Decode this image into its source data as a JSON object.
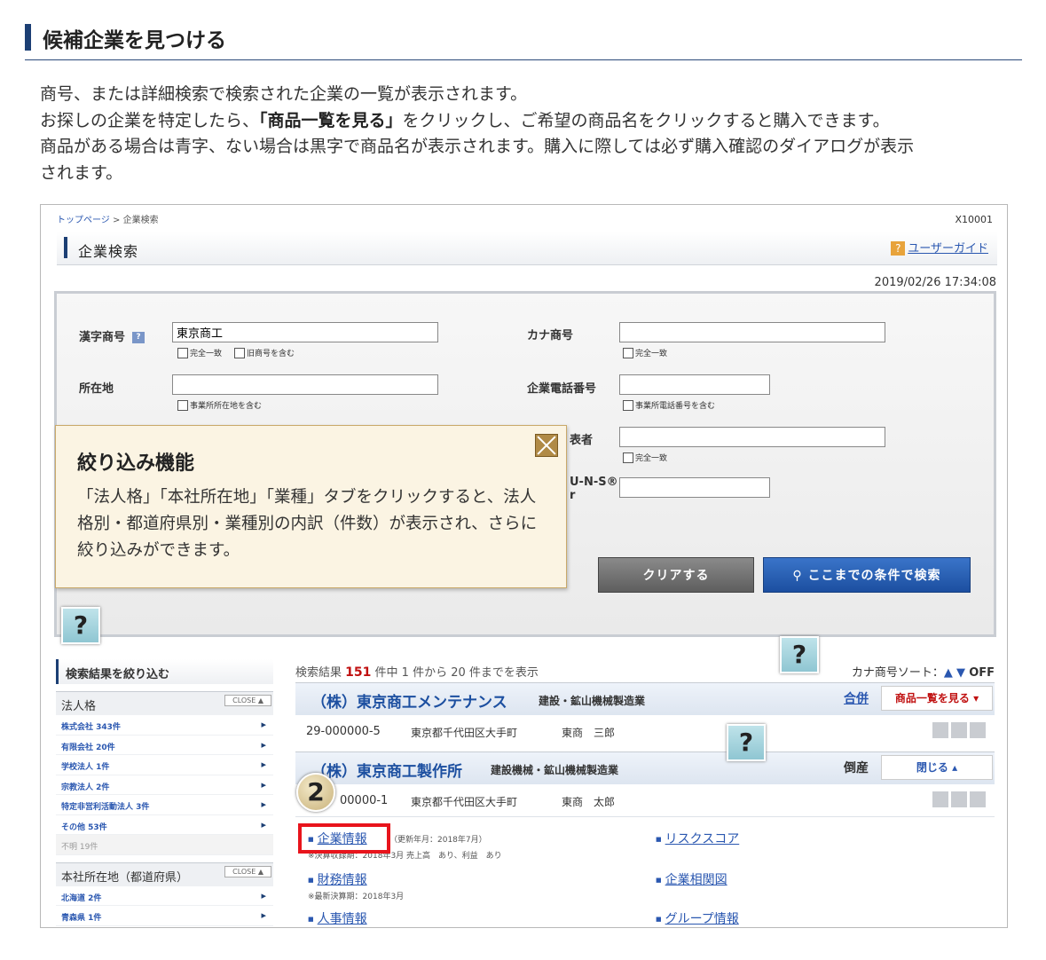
{
  "guide": {
    "title": "候補企業を見つける",
    "intro_line1": "商号、または詳細検索で検索された企業の一覧が表示されます。",
    "intro_line2_pre": "お探しの企業を特定したら、",
    "intro_line2_bold": "「商品一覧を見る」",
    "intro_line2_post": "をクリックし、ご希望の商品名をクリックすると購入できます。",
    "intro_line3": "商品がある場合は青字、ない場合は黒字で商品名が表示されます。購入に際しては必ず購入確認のダイアログが表示",
    "intro_line4": "されます。"
  },
  "screen": {
    "breadcrumb_top": "トップページ",
    "breadcrumb_sep": ">",
    "breadcrumb_current": "企業検索",
    "screen_id": "X10001",
    "page_title": "企業検索",
    "help_q": "?",
    "user_guide": "ユーザーガイド",
    "datetime": "2019/02/26 17:34:08"
  },
  "form": {
    "kanji_label": "漢字商号",
    "kanji_value": "東京商工",
    "chk_exact": "完全一致",
    "chk_former": "旧商号を含む",
    "kana_label": "カナ商号",
    "kana_value": "",
    "location_label": "所在地",
    "location_value": "",
    "chk_office_location": "事業所所在地を含む",
    "phone_label": "企業電話番号",
    "phone_value": "",
    "chk_office_phone": "事業所電話番号を含む",
    "rep_label_partial": "表者",
    "rep_value": "",
    "duns_label_partial": "U-N-S®",
    "duns_label_partial2": "r",
    "duns_value": "",
    "clear_btn": "クリアする",
    "search_btn": "ここまでの条件で検索"
  },
  "popup": {
    "title": "絞り込み機能",
    "body": "「法人格」「本社所在地」「業種」タブをクリックすると、法人格別・都道府県別・業種別の内訳（件数）が表示され、さらに絞り込みができます。"
  },
  "help_marks": [
    "?",
    "?",
    "?"
  ],
  "sidebar": {
    "heading": "検索結果を絞り込む",
    "close": "CLOSE ▲",
    "cat1": "法人格",
    "items1": [
      "株式会社 343件",
      "有限会社 20件",
      "学校法人 1件",
      "宗教法人 2件",
      "特定非営利活動法人 3件",
      "その他 53件"
    ],
    "disabled1": "不明 19件",
    "cat2": "本社所在地（都道府県）",
    "items2": [
      "北海道 2件",
      "青森県 1件"
    ]
  },
  "results": {
    "summary_pre": "検索結果",
    "total": "151",
    "summary_post": "件中 1 件から 20 件までを表示",
    "sort_label": "カナ商号ソート：",
    "sort_up": "▲",
    "sort_down": "▼",
    "sort_off": "OFF",
    "company1": {
      "name": "（株）東京商工メンテナンス",
      "industry": "建設・鉱山機械製造業",
      "status": "合併",
      "menu": "商品一覧を見る ▾",
      "id": "29-000000-5",
      "address": "東京都千代田区大手町",
      "rep": "東商　三郎"
    },
    "company2": {
      "name": "（株）東京商工製作所",
      "industry": "建設機械・鉱山機械製造業",
      "status": "倒産",
      "menu": "閉じる ▴",
      "id": "00000-1",
      "address": "東京都千代田区大手町",
      "rep": "東商　太郎"
    },
    "step_badge": "2",
    "links": {
      "company_info": "企業情報",
      "company_info_note": "（更新年月：2018年7月）",
      "company_info_sub": "※決算収録期：2018年3月 売上高　あり、利益　あり",
      "risk_score": "リスクスコア",
      "finance": "財務情報",
      "finance_sub": "※最新決算期：2018年3月",
      "correlation": "企業相関図",
      "personnel": "人事情報",
      "group": "グループ情報"
    }
  },
  "colors": {
    "accent": "#1c3f74",
    "link": "#2a57b0",
    "highlight": "#e8141c",
    "popup_bg": "#fbf4e3"
  }
}
